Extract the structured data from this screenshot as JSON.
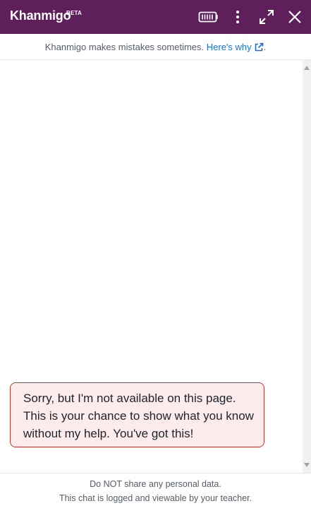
{
  "header": {
    "brand": "Khanmigo",
    "badge": "BETA",
    "background": "#5e1f5b",
    "icons": [
      "keyboard-icon",
      "more-vertical-icon",
      "expand-icon",
      "close-icon"
    ]
  },
  "notice": {
    "text": "Khanmigo makes mistakes sometimes.",
    "link_text": "Here's why",
    "suffix": ".",
    "link_color": "#1b6fd1",
    "link_icon": "external-link-icon"
  },
  "messages": [
    {
      "role": "assistant",
      "text": "Sorry, but I'm not available on this page. This is your chance to show what you know without my help. You've got this!",
      "background": "#fdecec",
      "border": "#c0392b"
    }
  ],
  "footer": {
    "line1": "Do NOT share any personal data.",
    "line2": "This chat is logged and viewable by your teacher."
  }
}
